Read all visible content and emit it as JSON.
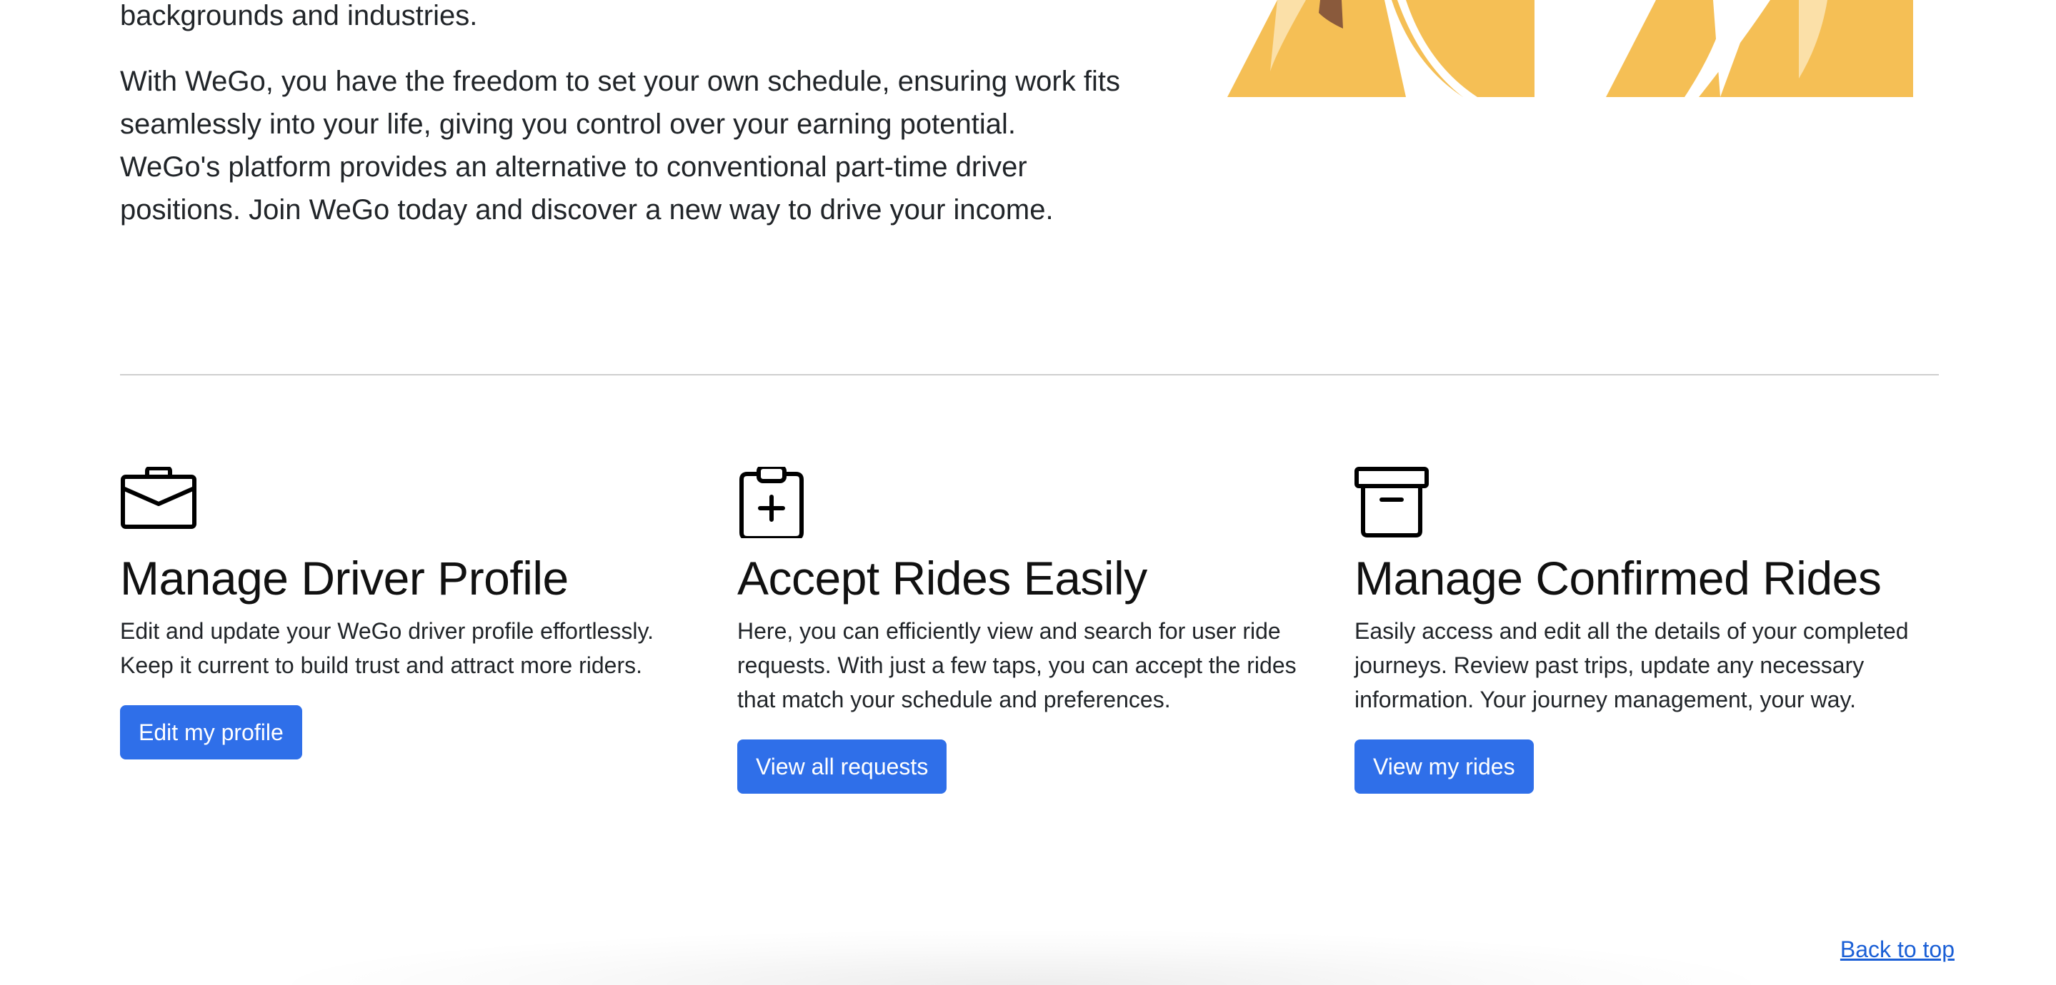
{
  "intro": {
    "lead_top": "backgrounds and industries.",
    "lead_main": "With WeGo, you have the freedom to set your own schedule, ensuring work fits seamlessly into your life, giving you control over your earning potential. WeGo's platform provides an alternative to conventional part-time driver positions. Join WeGo today and discover a new way to drive your income."
  },
  "features": [
    {
      "icon": "briefcase-icon",
      "title": "Manage Driver Profile",
      "description": "Edit and update your WeGo driver profile effortlessly. Keep it current to build trust and attract more riders.",
      "button_label": "Edit my profile"
    },
    {
      "icon": "clipboard-plus-icon",
      "title": "Accept Rides Easily",
      "description": "Here, you can efficiently view and search for user ride requests. With just a few taps, you can accept the rides that match your schedule and preferences.",
      "button_label": "View all requests"
    },
    {
      "icon": "archive-icon",
      "title": "Manage Confirmed Rides",
      "description": "Easily access and edit all the details of your completed journeys. Review past trips, update any necessary information. Your journey management, your way.",
      "button_label": "View my rides"
    }
  ],
  "footer": {
    "back_to_top_label": "Back to top"
  },
  "colors": {
    "button_bg": "#2f6fe9",
    "link": "#1a5fd6",
    "illustration_yellow": "#f5bf55",
    "illustration_brown": "#8a5a3c"
  }
}
